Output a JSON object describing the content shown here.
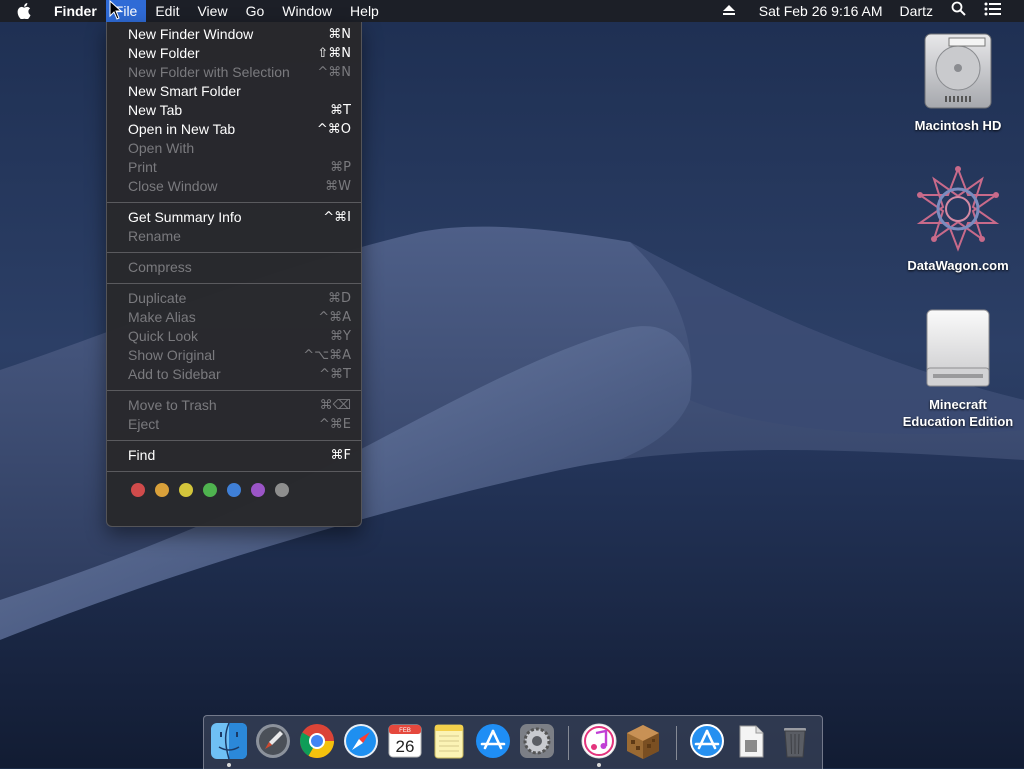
{
  "menubar": {
    "apple_icon": "apple-logo-icon",
    "app_name": "Finder",
    "menus": [
      "File",
      "Edit",
      "View",
      "Go",
      "Window",
      "Help"
    ],
    "active_menu": "File",
    "datetime": "Sat Feb 26  9:16 AM",
    "user": "Dartz",
    "right_icons": [
      "eject-icon",
      "spotlight-search-icon",
      "notification-center-icon"
    ]
  },
  "file_menu": {
    "items": [
      {
        "label": "New Finder Window",
        "shortcut": "⌘N",
        "enabled": true
      },
      {
        "label": "New Folder",
        "shortcut": "⇧⌘N",
        "enabled": true
      },
      {
        "label": "New Folder with Selection",
        "shortcut": "^⌘N",
        "enabled": false
      },
      {
        "label": "New Smart Folder",
        "shortcut": "",
        "enabled": true
      },
      {
        "label": "New Tab",
        "shortcut": "⌘T",
        "enabled": true
      },
      {
        "label": "Open in New Tab",
        "shortcut": "^⌘O",
        "enabled": true
      },
      {
        "label": "Open With",
        "shortcut": "",
        "enabled": false
      },
      {
        "label": "Print",
        "shortcut": "⌘P",
        "enabled": false
      },
      {
        "label": "Close Window",
        "shortcut": "⌘W",
        "enabled": false
      },
      {
        "label": "Get Summary Info",
        "shortcut": "^⌘I",
        "enabled": true
      },
      {
        "label": "Rename",
        "shortcut": "",
        "enabled": false
      },
      {
        "label": "Compress",
        "shortcut": "",
        "enabled": false
      },
      {
        "label": "Duplicate",
        "shortcut": "⌘D",
        "enabled": false
      },
      {
        "label": "Make Alias",
        "shortcut": "^⌘A",
        "enabled": false
      },
      {
        "label": "Quick Look",
        "shortcut": "⌘Y",
        "enabled": false
      },
      {
        "label": "Show Original",
        "shortcut": "^⌥⌘A",
        "enabled": false
      },
      {
        "label": "Add to Sidebar",
        "shortcut": "^⌘T",
        "enabled": false
      },
      {
        "label": "Move to Trash",
        "shortcut": "⌘⌫",
        "enabled": false
      },
      {
        "label": "Eject",
        "shortcut": "^⌘E",
        "enabled": false
      },
      {
        "label": "Find",
        "shortcut": "⌘F",
        "enabled": true
      }
    ],
    "tag_colors": [
      "#d04b4b",
      "#d9a03a",
      "#d3c53b",
      "#4fb34f",
      "#3f7fd6",
      "#9b55c7",
      "#8e8e8e"
    ]
  },
  "desktop": {
    "icons": [
      {
        "label": "Macintosh HD",
        "icon": "hard-drive-icon"
      },
      {
        "label": "DataWagon.com",
        "icon": "datawagon-logo-icon"
      },
      {
        "label": "Minecraft\nEducation Edition",
        "icon": "external-drive-icon"
      }
    ]
  },
  "dock": {
    "apps": [
      {
        "name": "Finder",
        "icon": "finder-icon",
        "running": true
      },
      {
        "name": "Launchpad",
        "icon": "launchpad-icon",
        "running": false
      },
      {
        "name": "Google Chrome",
        "icon": "chrome-icon",
        "running": false
      },
      {
        "name": "Safari",
        "icon": "safari-icon",
        "running": false
      },
      {
        "name": "Calendar",
        "icon": "calendar-icon",
        "running": false,
        "month": "FEB",
        "day": "26"
      },
      {
        "name": "Notes",
        "icon": "notes-icon",
        "running": false
      },
      {
        "name": "App Store",
        "icon": "app-store-icon",
        "running": false
      },
      {
        "name": "System Preferences",
        "icon": "system-preferences-icon",
        "running": false
      },
      {
        "name": "iTunes",
        "icon": "itunes-icon",
        "running": true
      },
      {
        "name": "Minecraft",
        "icon": "minecraft-icon",
        "running": false
      },
      {
        "name": "App Store Downloads",
        "icon": "app-store-folder-icon",
        "running": false
      },
      {
        "name": "Document",
        "icon": "document-icon",
        "running": false
      },
      {
        "name": "Trash",
        "icon": "trash-icon",
        "running": false
      }
    ]
  }
}
